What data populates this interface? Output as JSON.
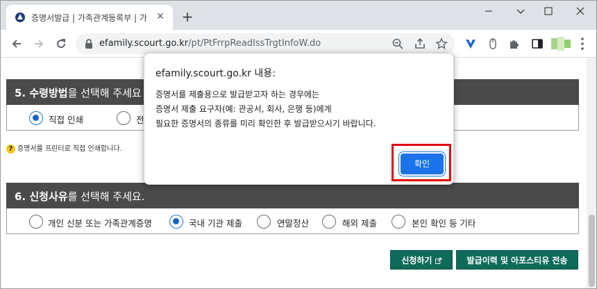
{
  "browser": {
    "tab_title": "증명서발급 | 가족관계등록부 | 가",
    "url_domain": "efamily.scourt.go.kr",
    "url_path": "/pt/PtFrrpReadIssTrgtInfoW.do"
  },
  "page": {
    "section5": {
      "title_bold": "5. 수령방법",
      "title_rest": "을 선택해 주세요",
      "options": [
        "직접 인쇄",
        "전"
      ],
      "selected_index": 0
    },
    "note_icon": "?",
    "note": "증명서를 프린터로 직접 인쇄합니다.",
    "section6": {
      "title_bold": "6. 신청사유",
      "title_rest": "를 선택해 주세요.",
      "options": [
        "개인 신분 또는 가족관계증명",
        "국내 기관 제출",
        "연말정산",
        "해외 제출",
        "본인 확인 등 기타"
      ],
      "selected_index": 1
    },
    "buttons": {
      "apply": "신청하기",
      "history": "발급이력 및 아포스티유 전송"
    }
  },
  "dialog": {
    "title": "efamily.scourt.go.kr 내용:",
    "lines": [
      "증명서를 제출용으로 발급받고자 하는 경우에는",
      "증명서 제출 요구자(예: 관공서, 회사, 은행 등)에게",
      "필요한 증명서의 종류를 미리 확인한 후 발급받으시기 바랍니다."
    ],
    "ok_label": "확인"
  },
  "colors": {
    "section_bar": "#4a4a4a",
    "radio_selected": "#1565c0",
    "green_button": "#0e6b5a",
    "dialog_button": "#1a73e8",
    "highlight": "#e00000"
  }
}
